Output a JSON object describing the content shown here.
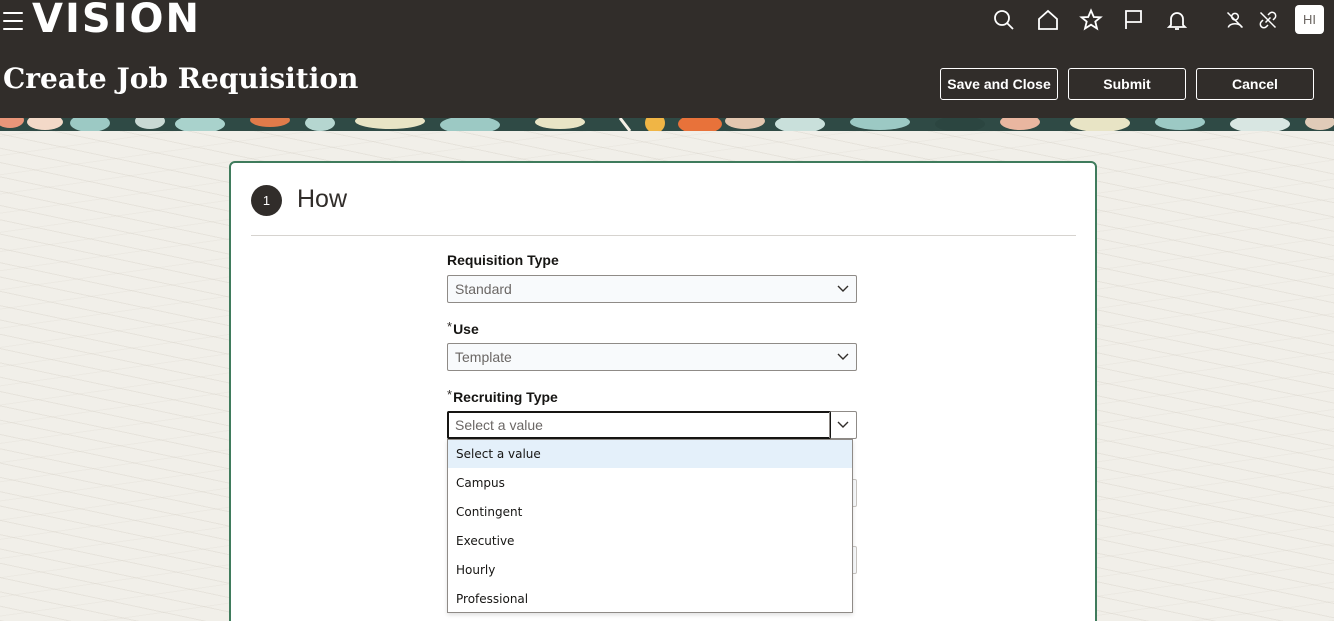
{
  "header": {
    "logo": "VISION",
    "page_title": "Create Job Requisition",
    "avatar_initials": "HI",
    "buttons": {
      "save_and_close": "Save and Close",
      "submit": "Submit",
      "cancel": "Cancel"
    },
    "icons": [
      "search-icon",
      "home-icon",
      "star-icon",
      "flag-icon",
      "bell-icon",
      "person-off-icon",
      "link-off-icon"
    ]
  },
  "step": {
    "number": "1",
    "title": "How"
  },
  "form": {
    "requisition_type": {
      "label": "Requisition Type",
      "value": "Standard",
      "required": false
    },
    "use": {
      "label": "Use",
      "value": "Template",
      "required": true
    },
    "recruiting_type": {
      "label": "Recruiting Type",
      "value": "Select a value",
      "required": true
    }
  },
  "dropdown": {
    "options": [
      "Select a value",
      "Campus",
      "Contingent",
      "Executive",
      "Hourly",
      "Professional"
    ],
    "highlighted": "Select a value"
  },
  "colors": {
    "header_bg": "#312d2a",
    "card_border": "#3f7b5c",
    "highlight": "#e4f0fa"
  }
}
